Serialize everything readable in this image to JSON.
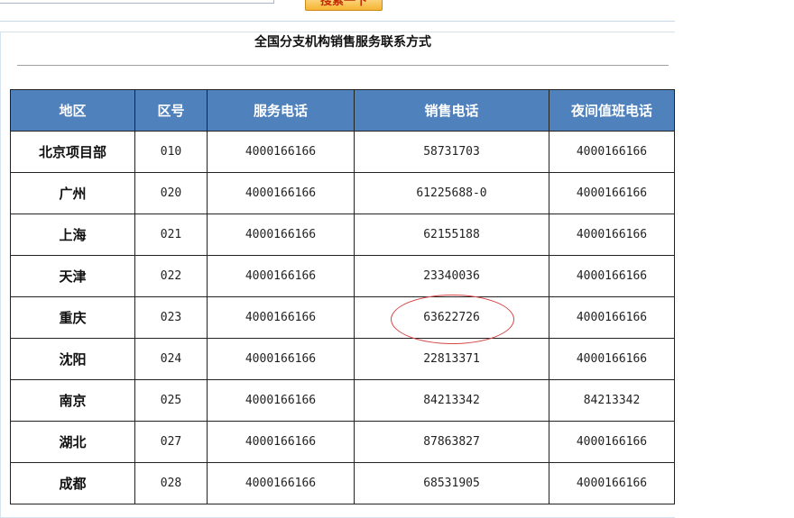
{
  "search": {
    "button_label": "搜索一下"
  },
  "page": {
    "title": "全国分支机构销售服务联系方式"
  },
  "table": {
    "headers": [
      "地区",
      "区号",
      "服务电话",
      "销售电话",
      "夜间值班电话"
    ],
    "rows": [
      {
        "region": "北京项目部",
        "area_code": "010",
        "service": "4000166166",
        "sales": "58731703",
        "night": "4000166166"
      },
      {
        "region": "广州",
        "area_code": "020",
        "service": "4000166166",
        "sales": "61225688-0",
        "night": "4000166166"
      },
      {
        "region": "上海",
        "area_code": "021",
        "service": "4000166166",
        "sales": "62155188",
        "night": "4000166166"
      },
      {
        "region": "天津",
        "area_code": "022",
        "service": "4000166166",
        "sales": "23340036",
        "night": "4000166166"
      },
      {
        "region": "重庆",
        "area_code": "023",
        "service": "4000166166",
        "sales": "63622726",
        "night": "4000166166"
      },
      {
        "region": "沈阳",
        "area_code": "024",
        "service": "4000166166",
        "sales": "22813371",
        "night": "4000166166"
      },
      {
        "region": "南京",
        "area_code": "025",
        "service": "4000166166",
        "sales": "84213342",
        "night": "84213342"
      },
      {
        "region": "湖北",
        "area_code": "027",
        "service": "4000166166",
        "sales": "87863827",
        "night": "4000166166"
      },
      {
        "region": "成都",
        "area_code": "028",
        "service": "4000166166",
        "sales": "68531905",
        "night": "4000166166"
      }
    ]
  },
  "colors": {
    "header_bg": "#4f81bd",
    "annotation": "#d64545",
    "button": "#f6b432"
  }
}
